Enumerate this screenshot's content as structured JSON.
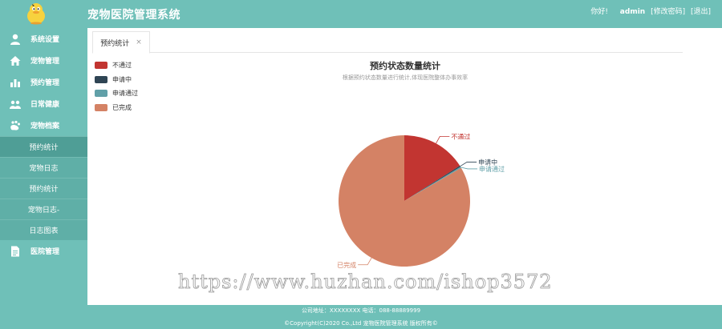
{
  "header": {
    "title": "宠物医院管理系统",
    "greeting": "你好!",
    "username": "admin",
    "change_password": "[修改密码]",
    "logout": "[退出]"
  },
  "sidebar": {
    "items": [
      {
        "label": "系统设置",
        "icon": "user-icon"
      },
      {
        "label": "宠物管理",
        "icon": "home-icon"
      },
      {
        "label": "预约管理",
        "icon": "bar-chart-icon"
      },
      {
        "label": "日常健康",
        "icon": "users-icon"
      },
      {
        "label": "宠物档案",
        "icon": "pet-archive-icon"
      }
    ],
    "subitems": [
      {
        "label": "预约统计",
        "active": true
      },
      {
        "label": "宠物日志"
      },
      {
        "label": "预约统计"
      },
      {
        "label": "宠物日志-"
      },
      {
        "label": "日志图表"
      }
    ],
    "last_item": {
      "label": "医院管理",
      "icon": "document-icon"
    }
  },
  "tabs": [
    {
      "label": "预约统计",
      "close": "×"
    }
  ],
  "chart_data": {
    "type": "pie",
    "title": "预约状态数量统计",
    "subtitle": "根据预约状态数量进行统计,体现医院整体办事效率",
    "legend_position": "top-left",
    "categories": [
      "不通过",
      "申请中",
      "申请通过",
      "已完成"
    ],
    "values": [
      16,
      0.3,
      0.3,
      83.4
    ],
    "colors": [
      "#c23531",
      "#2f4554",
      "#61a0a8",
      "#d48265"
    ]
  },
  "footer": {
    "line1": "公司地址：XXXXXXXX 电话：088-88889999",
    "line2": "©Copyright(C)2020 Co.,Ltd 宠物医院管理系统 版权所有©"
  },
  "watermark": "https://www.huzhan.com/ishop3572"
}
